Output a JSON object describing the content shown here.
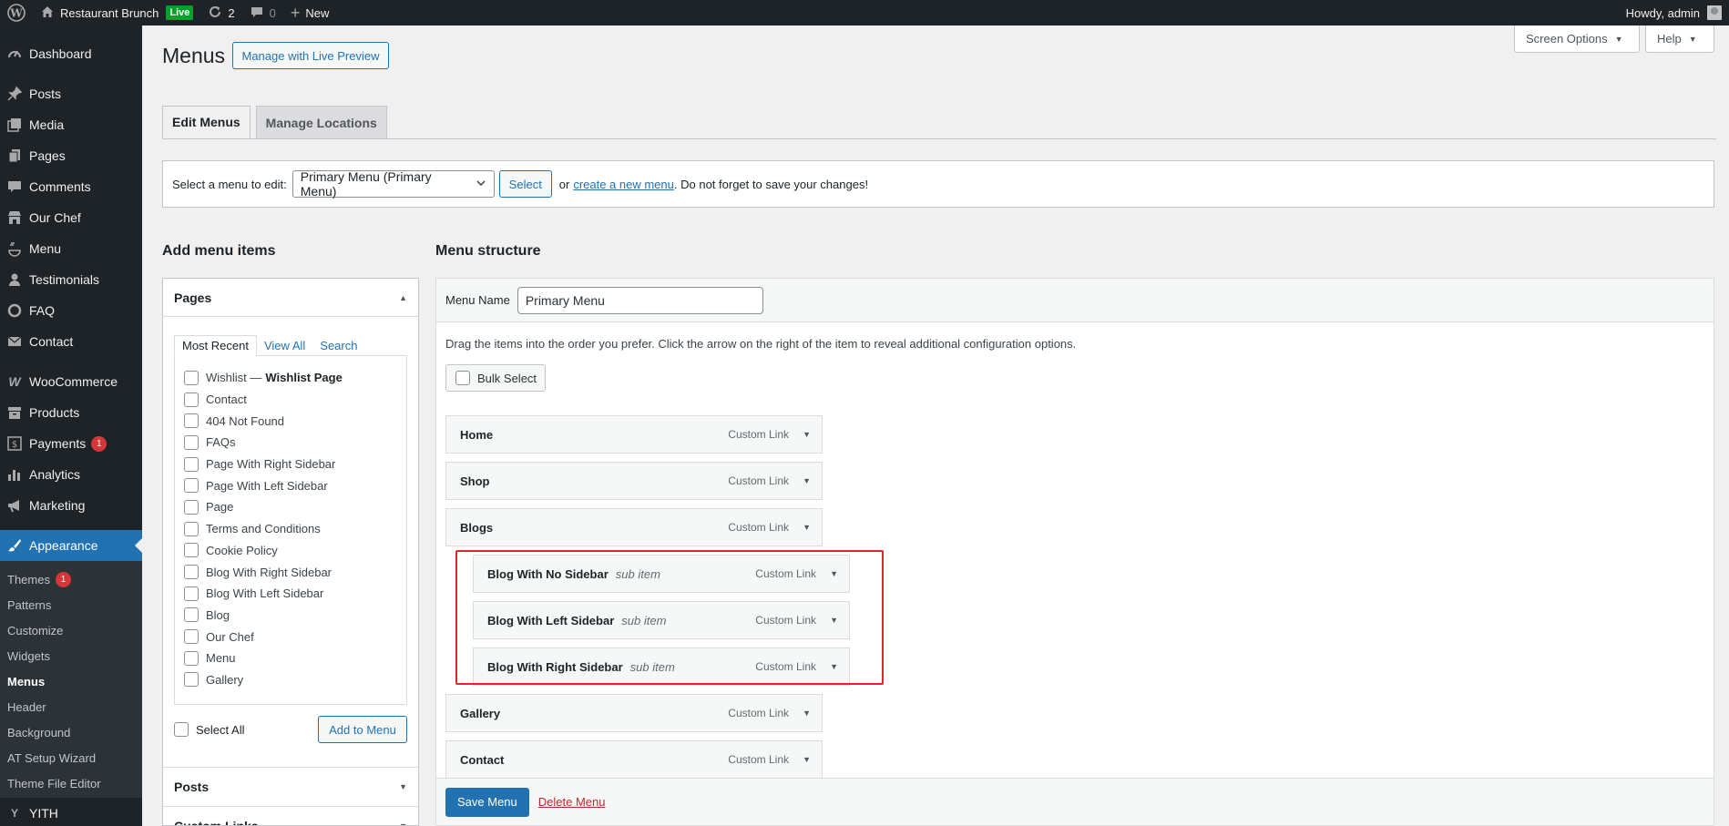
{
  "adminbar": {
    "site_name": "Restaurant Brunch",
    "live_label": "Live",
    "updates_count": "2",
    "comments_count": "0",
    "new_label": "New",
    "howdy": "Howdy, admin"
  },
  "sidebar": {
    "items": [
      {
        "label": "Dashboard",
        "icon": "dashboard-icon"
      },
      {
        "label": "Posts",
        "icon": "pin-icon"
      },
      {
        "label": "Media",
        "icon": "media-icon"
      },
      {
        "label": "Pages",
        "icon": "page-icon"
      },
      {
        "label": "Comments",
        "icon": "comment-icon"
      },
      {
        "label": "Our Chef",
        "icon": "store-icon"
      },
      {
        "label": "Menu",
        "icon": "menu-icon"
      },
      {
        "label": "Testimonials",
        "icon": "user-icon"
      },
      {
        "label": "FAQ",
        "icon": "circle-icon"
      },
      {
        "label": "Contact",
        "icon": "mail-icon"
      },
      {
        "label": "WooCommerce",
        "icon": "woo-icon"
      },
      {
        "label": "Products",
        "icon": "archive-icon"
      },
      {
        "label": "Payments",
        "icon": "dollar-icon",
        "badge": "1"
      },
      {
        "label": "Analytics",
        "icon": "chart-icon"
      },
      {
        "label": "Marketing",
        "icon": "megaphone-icon"
      },
      {
        "label": "Appearance",
        "icon": "brush-icon"
      },
      {
        "label": "YITH",
        "icon": "yith-icon"
      }
    ],
    "submenu": [
      {
        "label": "Themes",
        "badge": "1"
      },
      {
        "label": "Patterns"
      },
      {
        "label": "Customize"
      },
      {
        "label": "Widgets"
      },
      {
        "label": "Menus"
      },
      {
        "label": "Header"
      },
      {
        "label": "Background"
      },
      {
        "label": "AT Setup Wizard"
      },
      {
        "label": "Theme File Editor"
      }
    ]
  },
  "header": {
    "title": "Menus",
    "live_preview_label": "Manage with Live Preview",
    "screen_options_label": "Screen Options",
    "help_label": "Help"
  },
  "tabs": [
    {
      "label": "Edit Menus"
    },
    {
      "label": "Manage Locations"
    }
  ],
  "select_bar": {
    "prompt": "Select a menu to edit:",
    "selected": "Primary Menu (Primary Menu)",
    "select_button": "Select",
    "or_text": "or",
    "create_link": "create a new menu",
    "reminder": ". Do not forget to save your changes!"
  },
  "add_items": {
    "title": "Add menu items",
    "pages_title": "Pages",
    "inner_tabs": [
      "Most Recent",
      "View All",
      "Search"
    ],
    "pages": [
      {
        "label": "Wishlist —",
        "bold": "Wishlist Page"
      },
      {
        "label": "Contact"
      },
      {
        "label": "404 Not Found"
      },
      {
        "label": "FAQs"
      },
      {
        "label": "Page With Right Sidebar"
      },
      {
        "label": "Page With Left Sidebar"
      },
      {
        "label": "Page"
      },
      {
        "label": "Terms and Conditions"
      },
      {
        "label": "Cookie Policy"
      },
      {
        "label": "Blog With Right Sidebar"
      },
      {
        "label": "Blog With Left Sidebar"
      },
      {
        "label": "Blog"
      },
      {
        "label": "Our Chef"
      },
      {
        "label": "Menu"
      },
      {
        "label": "Gallery"
      }
    ],
    "select_all": "Select All",
    "add_button": "Add to Menu",
    "posts_title": "Posts",
    "custom_links_title": "Custom Links"
  },
  "structure": {
    "title": "Menu structure",
    "menu_name_label": "Menu Name",
    "menu_name_value": "Primary Menu",
    "instructions": "Drag the items into the order you prefer. Click the arrow on the right of the item to reveal additional configuration options.",
    "bulk_select": "Bulk Select",
    "items": [
      {
        "title": "Home",
        "type": "Custom Link",
        "sub": ""
      },
      {
        "title": "Shop",
        "type": "Custom Link",
        "sub": ""
      },
      {
        "title": "Blogs",
        "type": "Custom Link",
        "sub": ""
      },
      {
        "title": "Blog With No Sidebar",
        "type": "Custom Link",
        "sub": "sub item"
      },
      {
        "title": "Blog With Left Sidebar",
        "type": "Custom Link",
        "sub": "sub item"
      },
      {
        "title": "Blog With Right Sidebar",
        "type": "Custom Link",
        "sub": "sub item"
      },
      {
        "title": "Gallery",
        "type": "Custom Link",
        "sub": ""
      },
      {
        "title": "Contact",
        "type": "Custom Link",
        "sub": ""
      }
    ],
    "save_button": "Save Menu",
    "delete_link": "Delete Menu"
  },
  "colors": {
    "accent": "#2271b1",
    "admin_dark": "#1d2327",
    "highlight_box": "#e0272b",
    "badge": "#d63638"
  }
}
